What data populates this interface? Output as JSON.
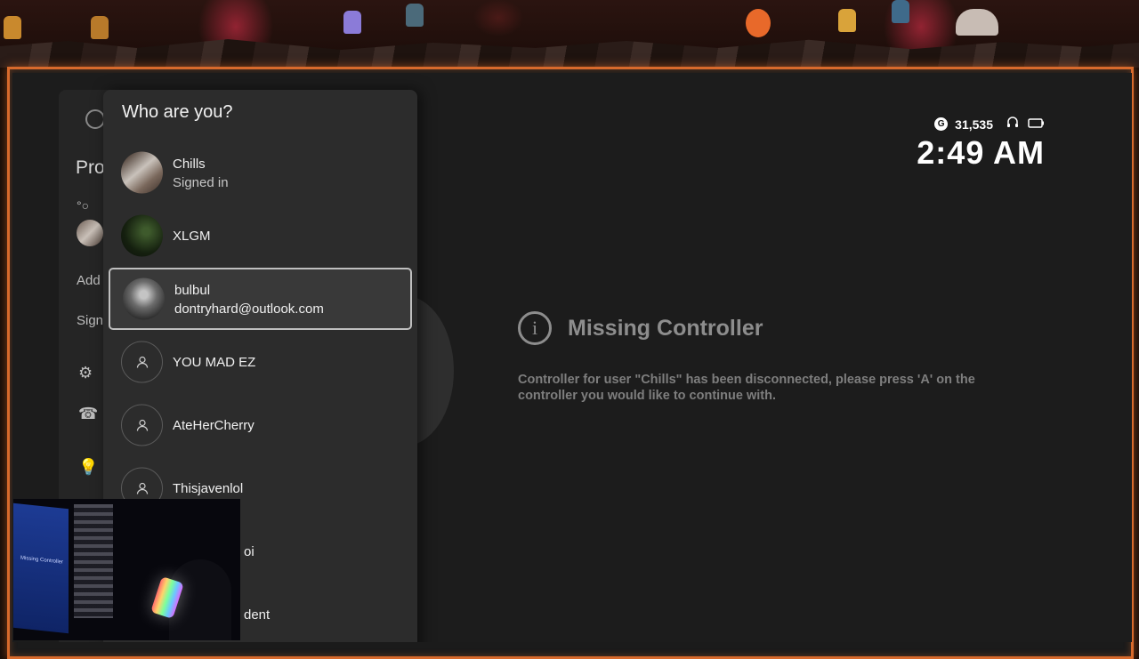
{
  "status": {
    "gamerscore": "31,535",
    "time": "2:49 AM",
    "gamerscore_icon": "G"
  },
  "guide": {
    "title_partial": "Pro",
    "add_partial": "Add",
    "sign_partial": "Sign"
  },
  "account_picker": {
    "title": "Who are you?",
    "accounts": [
      {
        "name": "Chills",
        "sub": "Signed in",
        "avatar": "photo"
      },
      {
        "name": "XLGM",
        "sub": "",
        "avatar": "photo"
      },
      {
        "name": "bulbul",
        "sub": "dontryhard@outlook.com",
        "avatar": "photo",
        "selected": true
      },
      {
        "name": "YOU MAD EZ",
        "sub": "",
        "avatar": "generic-person-icon"
      },
      {
        "name": "AteHerCherry",
        "sub": "",
        "avatar": "generic-person-icon"
      },
      {
        "name": "Thisjavenlol",
        "sub": "",
        "avatar": "generic-person-icon"
      },
      {
        "name": "oi",
        "sub": "",
        "avatar": "obscured"
      },
      {
        "name": "dent",
        "sub": "",
        "avatar": "obscured"
      }
    ]
  },
  "missing_controller": {
    "title": "Missing Controller",
    "message": "Controller for user \"Chills\" has been disconnected, please press 'A' on the controller you would like to continue with."
  },
  "webcam": {
    "screen_caption": "Missing Controller"
  },
  "colors": {
    "frame_orange": "#d86a2c",
    "panel_bg": "#2c2c2c",
    "selection_border": "#bfbfbf",
    "muted_text": "#8d8d8d"
  }
}
